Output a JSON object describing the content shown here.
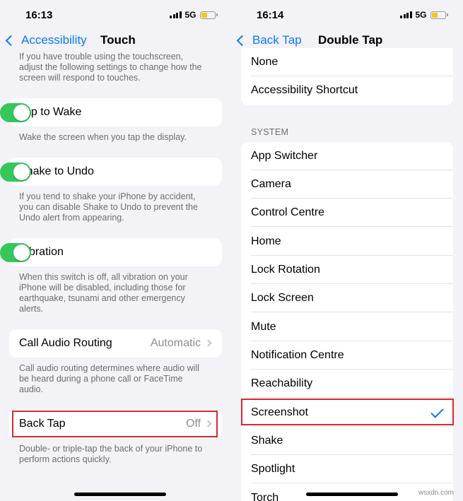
{
  "left": {
    "status": {
      "time": "16:13",
      "network": "5G"
    },
    "nav": {
      "back_label": "Accessibility",
      "title": "Touch"
    },
    "intro_text": [
      "If you have trouble using the touchscreen,",
      "adjust the following settings to change how the",
      "screen will respond to touches."
    ],
    "tap_to_wake": {
      "label": "Tap to Wake",
      "on": true,
      "desc": [
        "Wake the screen when you tap the display."
      ]
    },
    "shake_to_undo": {
      "label": "Shake to Undo",
      "on": true,
      "desc": [
        "If you tend to shake your iPhone by accident,",
        "you can disable Shake to Undo to prevent the",
        "Undo alert from appearing."
      ]
    },
    "vibration": {
      "label": "Vibration",
      "on": true,
      "desc": [
        "When this switch is off, all vibration on your",
        "iPhone will be disabled, including those for",
        "earthquake, tsunami and other emergency",
        "alerts."
      ]
    },
    "call_audio": {
      "label": "Call Audio Routing",
      "value": "Automatic",
      "desc": [
        "Call audio routing determines where audio will",
        "be heard during a phone call or FaceTime",
        "audio."
      ]
    },
    "back_tap": {
      "label": "Back Tap",
      "value": "Off",
      "desc": [
        "Double- or triple-tap the back of your iPhone to",
        "perform actions quickly."
      ]
    }
  },
  "right": {
    "status": {
      "time": "16:14",
      "network": "5G"
    },
    "nav": {
      "back_label": "Back Tap",
      "title": "Double Tap"
    },
    "top_items": [
      "None",
      "Accessibility Shortcut"
    ],
    "section_title": "SYSTEM",
    "system_items": [
      "App Switcher",
      "Camera",
      "Control Centre",
      "Home",
      "Lock Rotation",
      "Lock Screen",
      "Mute",
      "Notification Centre",
      "Reachability",
      "Screenshot",
      "Shake",
      "Spotlight",
      "Torch"
    ],
    "selected": "Screenshot"
  },
  "colors": {
    "accent": "#0a7aff",
    "toggle_on": "#34c759",
    "highlight": "#d9272e",
    "battery": "#f5c518"
  },
  "watermark": "wsxdn.com"
}
